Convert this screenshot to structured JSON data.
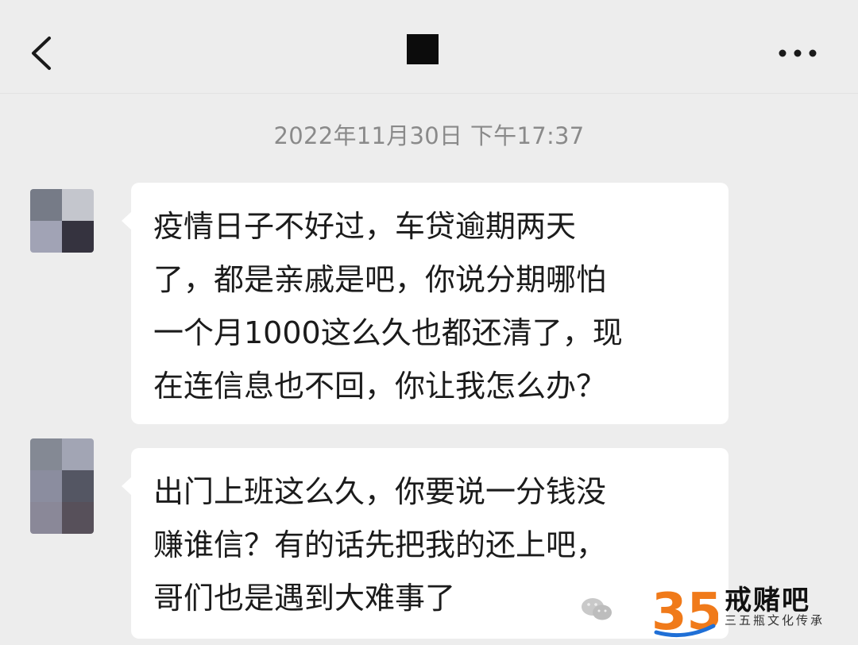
{
  "header": {
    "back_icon": "chevron-left-icon",
    "contact_name_redacted": true,
    "more_icon": "more-horizontal-icon"
  },
  "chat": {
    "timestamp": "2022年11月30日 下午17:37",
    "messages": [
      {
        "side": "left",
        "text": "疫情日子不好过，车贷逾期两天\n了，都是亲戚是吧，你说分期哪怕\n一个月1000这么久也都还清了，现\n在连信息也不回，你让我怎么办？"
      },
      {
        "side": "left",
        "text": "出门上班这么久，你要说一分钱没\n赚谁信？有的话先把我的还上吧，\n哥们也是遇到大难事了"
      }
    ]
  },
  "watermark": {
    "logo_text": "35",
    "name": "戒赌吧",
    "subtitle": "三五瓶文化传承",
    "icon": "wechat-icon"
  }
}
